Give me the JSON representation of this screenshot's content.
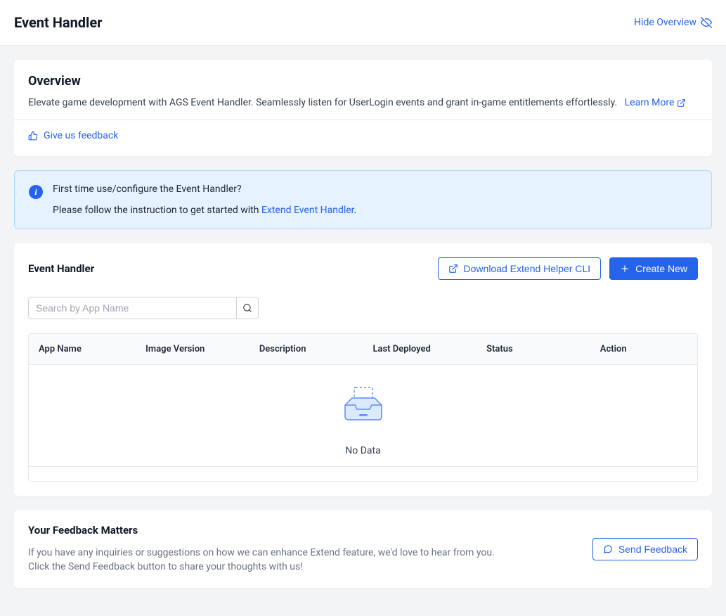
{
  "header": {
    "title": "Event Handler",
    "hide_overview": "Hide Overview"
  },
  "overview": {
    "title": "Overview",
    "description": "Elevate game development with AGS Event Handler. Seamlessly listen for UserLogin events and grant in-game entitlements effortlessly.",
    "learn_more": "Learn More",
    "feedback_link": "Give us feedback"
  },
  "info_banner": {
    "heading": "First time use/configure the Event Handler?",
    "lead_text": "Please follow the instruction to get started with ",
    "link_text": "Extend Event Handler",
    "period": "."
  },
  "section": {
    "title": "Event Handler",
    "download_cli": "Download Extend Helper CLI",
    "create_new": "Create New",
    "search_placeholder": "Search by App Name",
    "columns": {
      "app_name": "App Name",
      "image_version": "Image Version",
      "description": "Description",
      "last_deployed": "Last Deployed",
      "status": "Status",
      "action": "Action"
    },
    "empty": "No Data"
  },
  "feedback": {
    "title": "Your Feedback Matters",
    "line1": "If you have any inquiries or suggestions on how we can enhance Extend feature, we'd love to hear from you.",
    "line2": "Click the Send Feedback button to share your thoughts with us!",
    "button": "Send Feedback"
  }
}
